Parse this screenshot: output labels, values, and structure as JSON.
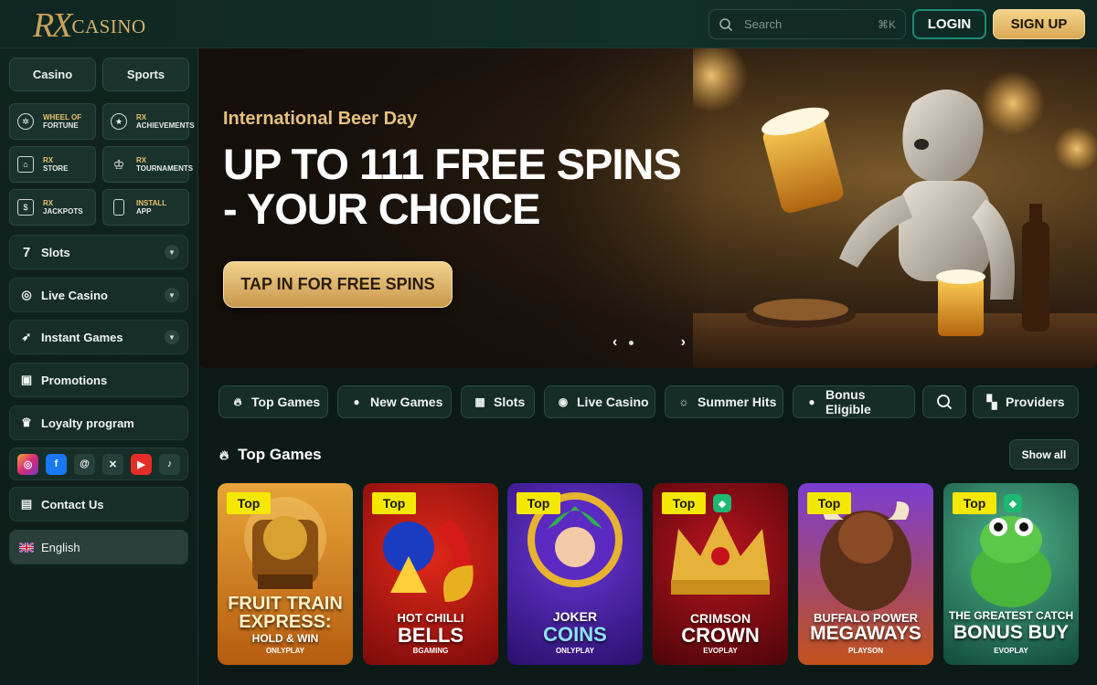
{
  "header": {
    "logo_rx": "RX",
    "logo_casino": "CASINO",
    "search_placeholder": "Search",
    "search_shortcut": "⌘K",
    "login_label": "LOGIN",
    "signup_label": "SIGN UP"
  },
  "sidebar": {
    "top_tabs": [
      "Casino",
      "Sports"
    ],
    "tiles": [
      {
        "gold": "WHEEL OF",
        "line2": "FORTUNE",
        "icon": "wheel-icon"
      },
      {
        "gold": "RX",
        "line2": "ACHIEVEMENTS",
        "icon": "achievements-icon"
      },
      {
        "gold": "RX",
        "line2": "STORE",
        "icon": "store-icon"
      },
      {
        "gold": "RX",
        "line2": "TOURNAMENTS",
        "icon": "trophy-icon"
      },
      {
        "gold": "RX",
        "line2": "JACKPOTS",
        "icon": "jackpot-icon"
      },
      {
        "gold": "INSTALL",
        "line2": "APP",
        "icon": "phone-icon"
      }
    ],
    "nav": [
      {
        "label": "Slots",
        "icon": "slot-seven-icon",
        "expandable": true
      },
      {
        "label": "Live Casino",
        "icon": "chip-icon",
        "expandable": true
      },
      {
        "label": "Instant Games",
        "icon": "rocket-icon",
        "expandable": true
      },
      {
        "label": "Promotions",
        "icon": "gift-icon",
        "expandable": false
      },
      {
        "label": "Loyalty program",
        "icon": "crown-icon",
        "expandable": false
      }
    ],
    "socials": [
      "instagram-icon",
      "facebook-icon",
      "threads-icon",
      "x-icon",
      "youtube-icon",
      "tiktok-icon"
    ],
    "contact_label": "Contact Us",
    "language_label": "English"
  },
  "banner": {
    "subtitle": "International Beer Day",
    "title_line1": "UP TO 111 FREE SPINS",
    "title_line2": "- YOUR CHOICE",
    "cta_label": "TAP IN FOR FREE SPINS"
  },
  "categories": [
    {
      "label": "Top Games",
      "icon": "flame-icon"
    },
    {
      "label": "New Games",
      "icon": "new-icon"
    },
    {
      "label": "Slots",
      "icon": "slots-icon"
    },
    {
      "label": "Live Casino",
      "icon": "chip-icon"
    },
    {
      "label": "Summer Hits",
      "icon": "sun-icon"
    },
    {
      "label": "Bonus Eligible",
      "icon": "bonus-icon"
    },
    {
      "label": "",
      "icon": "search-icon"
    },
    {
      "label": "Providers",
      "icon": "grid-icon"
    }
  ],
  "section": {
    "title": "Top Games",
    "show_all": "Show all"
  },
  "games": [
    {
      "badge": "Top",
      "line1": "FRUIT TRAIN",
      "line2": "EXPRESS:",
      "line3": "HOLD & WIN",
      "provider": "ONLYPLAY",
      "gem": false
    },
    {
      "badge": "Top",
      "line1": "HOT CHILLI",
      "line2": "BELLS",
      "line3": "",
      "provider": "BGAMING",
      "gem": false
    },
    {
      "badge": "Top",
      "line1": "JOKER",
      "line2": "COINS",
      "line3": "",
      "provider": "ONLYPLAY",
      "gem": false
    },
    {
      "badge": "Top",
      "line1": "CRIMSON",
      "line2": "CROWN",
      "line3": "",
      "provider": "EVOPLAY",
      "gem": true
    },
    {
      "badge": "Top",
      "line1": "BUFFALO POWER",
      "line2": "MEGAWAYS",
      "line3": "",
      "provider": "PLAYSON",
      "gem": false
    },
    {
      "badge": "Top",
      "line1": "THE GREATEST CATCH",
      "line2": "BONUS BUY",
      "line3": "",
      "provider": "EVOPLAY",
      "gem": true
    }
  ]
}
